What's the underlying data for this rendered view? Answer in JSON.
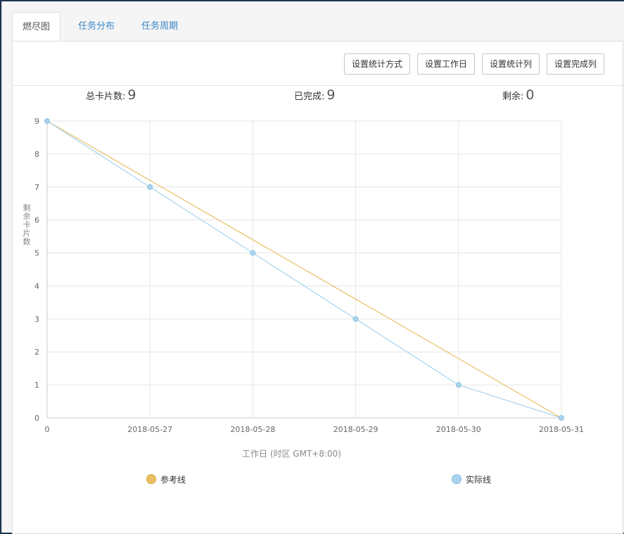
{
  "tabs": [
    {
      "label": "燃尽图",
      "active": true
    },
    {
      "label": "任务分布",
      "active": false
    },
    {
      "label": "任务周期",
      "active": false
    }
  ],
  "toolbar": {
    "buttons": [
      "设置统计方式",
      "设置工作日",
      "设置统计列",
      "设置完成列"
    ]
  },
  "stats": {
    "total_label": "总卡片数:",
    "total_value": "9",
    "done_label": "已完成:",
    "done_value": "9",
    "remain_label": "剩余:",
    "remain_value": "0"
  },
  "colors": {
    "reference": "#e8c063",
    "actual": "#a8d4ee",
    "tab_link": "#3a87c8"
  },
  "chart_data": {
    "type": "line",
    "categories": [
      "0",
      "2018-05-27",
      "2018-05-28",
      "2018-05-29",
      "2018-05-30",
      "2018-05-31"
    ],
    "series": [
      {
        "name": "参考线",
        "values": [
          9,
          7.2,
          5.4,
          3.6,
          1.8,
          0
        ]
      },
      {
        "name": "实际线",
        "values": [
          9,
          7,
          5,
          3,
          1,
          0
        ]
      }
    ],
    "xlabel": "工作日 (时区 GMT+8:00)",
    "ylabel": "剩余卡片数",
    "ylim": [
      0,
      9
    ],
    "yticks": [
      0,
      1,
      2,
      3,
      4,
      5,
      6,
      7,
      8,
      9
    ],
    "grid": true,
    "legend": "bottom"
  }
}
